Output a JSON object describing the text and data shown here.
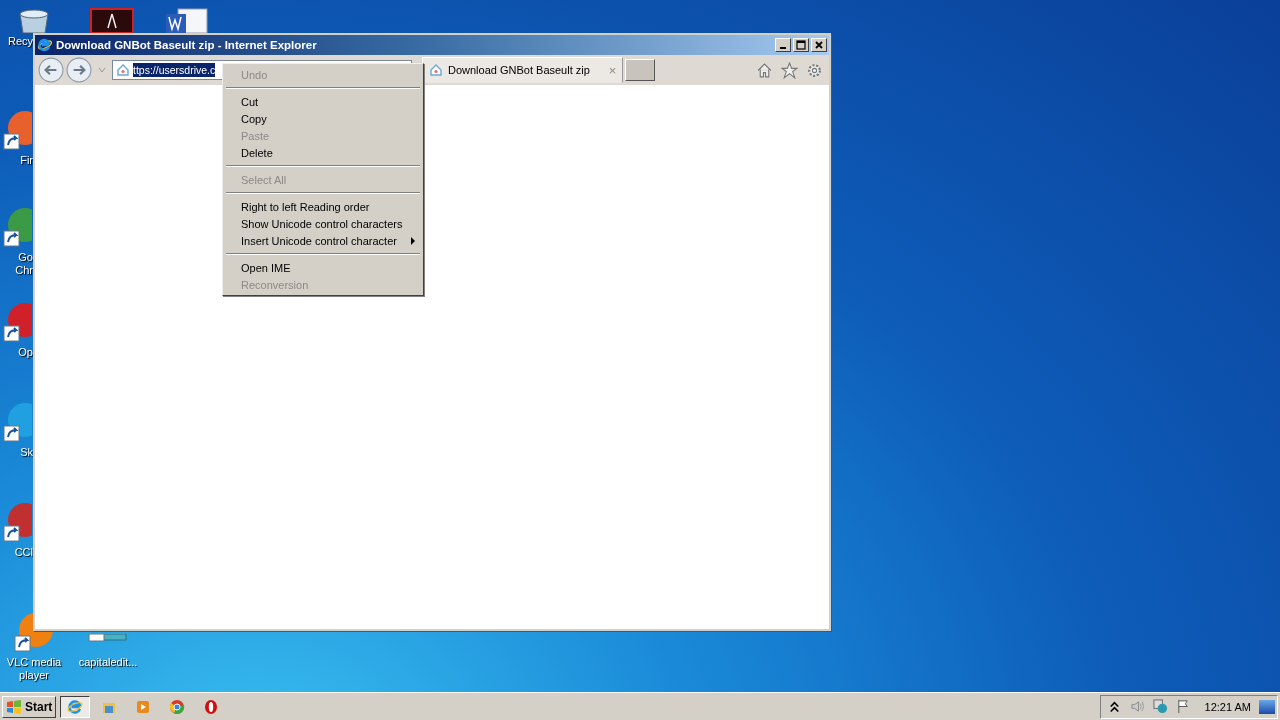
{
  "desktop_icons": [
    {
      "lines": [
        "Recy"
      ]
    },
    {
      "lines": [
        "Fir"
      ]
    },
    {
      "lines": [
        "Go",
        "Chr"
      ]
    },
    {
      "lines": [
        "Op"
      ]
    },
    {
      "lines": [
        "Sk"
      ]
    },
    {
      "lines": [
        "CCl"
      ]
    },
    {
      "lines": [
        "VLC media",
        "player"
      ]
    },
    {
      "lines": [
        "capitaledit..."
      ]
    }
  ],
  "window": {
    "title": "Download GNBot Baseult zip - Internet Explorer",
    "address": {
      "value": "ttps://usersdrive.c",
      "selected": true
    },
    "tabs": [
      {
        "label": "Download GNBot Baseult zip",
        "close": "×",
        "selected": true
      }
    ]
  },
  "context_menu": [
    {
      "kind": "item",
      "label": "Undo",
      "disabled": true
    },
    {
      "kind": "separator"
    },
    {
      "kind": "item",
      "label": "Cut",
      "disabled": false
    },
    {
      "kind": "item",
      "label": "Copy",
      "disabled": false
    },
    {
      "kind": "item",
      "label": "Paste",
      "disabled": true
    },
    {
      "kind": "item",
      "label": "Delete",
      "disabled": false
    },
    {
      "kind": "separator"
    },
    {
      "kind": "item",
      "label": "Select All",
      "disabled": true
    },
    {
      "kind": "separator"
    },
    {
      "kind": "item",
      "label": "Right to left Reading order",
      "disabled": false
    },
    {
      "kind": "item",
      "label": "Show Unicode control characters",
      "disabled": false
    },
    {
      "kind": "item",
      "label": "Insert Unicode control character",
      "disabled": false,
      "submenu": true
    },
    {
      "kind": "separator"
    },
    {
      "kind": "item",
      "label": "Open IME",
      "disabled": false
    },
    {
      "kind": "item",
      "label": "Reconversion",
      "disabled": true
    }
  ],
  "taskbar": {
    "start": "Start",
    "apps": [
      {
        "selected": true
      },
      {
        "selected": false
      },
      {
        "selected": false
      },
      {
        "selected": false
      },
      {
        "selected": false
      }
    ],
    "clock": "12:21 AM"
  }
}
